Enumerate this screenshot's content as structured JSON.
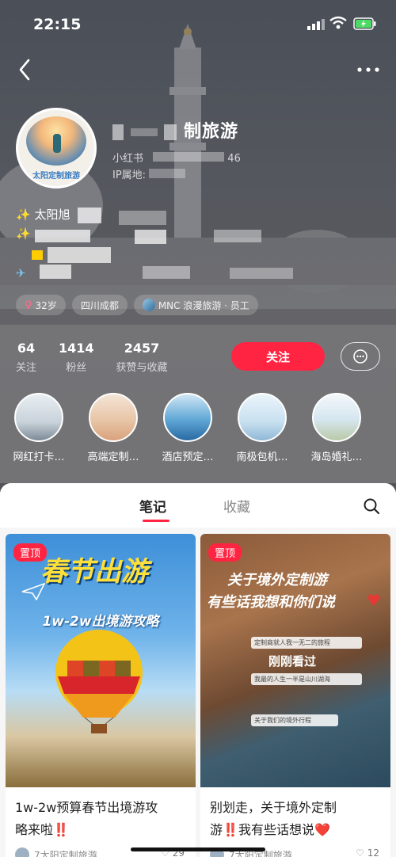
{
  "status_bar": {
    "time": "22:15"
  },
  "profile": {
    "name": "制旅游",
    "platform_line": "小红书",
    "id_suffix": "46",
    "ip_label": "IP属地:",
    "avatar_text": "太阳定制旅游",
    "bio_line1": "太阳旭",
    "tags": [
      {
        "icon": "female-icon",
        "text": "32岁"
      },
      {
        "icon": "",
        "text": "四川成都"
      },
      {
        "icon": "company-logo-icon",
        "text": "MNC 浪漫旅游 · 员工"
      }
    ]
  },
  "stats": [
    {
      "value": "64",
      "label": "关注"
    },
    {
      "value": "1414",
      "label": "粉丝"
    },
    {
      "value": "2457",
      "label": "获赞与收藏"
    }
  ],
  "actions": {
    "follow_label": "关注"
  },
  "collections": [
    {
      "label": "网红打卡…"
    },
    {
      "label": "高端定制…"
    },
    {
      "label": "酒店预定…"
    },
    {
      "label": "南极包机…"
    },
    {
      "label": "海岛婚礼…"
    }
  ],
  "tabs": {
    "notes": "笔记",
    "favorites": "收藏"
  },
  "notes": [
    {
      "badge": "置顶",
      "cover_headline": "春节出游",
      "cover_sub": "1w-2w出境游攻略",
      "title_line1": "1w-2w预算春节出境游攻",
      "title_line2": "略来啦",
      "title_emoji": "‼️",
      "author": "7太阳定制旅游",
      "likes": "29"
    },
    {
      "badge": "置顶",
      "cover_headline1": "关于境外定制游",
      "cover_headline2": "有些话我想和你们说",
      "cover_mid": "刚刚看过",
      "cover_bubble1": "定制商就人我一无二的旅程",
      "cover_bubble2": "我最的人生一半是山川湖海",
      "cover_bubble3": "关于我们的境外行程",
      "title_line1": "别划走，关于境外定制",
      "title_line2": "游",
      "title_line2b": "我有些话想说",
      "title_emoji": "‼️",
      "title_heart": "❤️",
      "author": "7太阳定制旅游",
      "likes": "12"
    }
  ],
  "colors": {
    "accent": "#ff2442",
    "hero_bg": "#545458",
    "sheet_bg": "#f6f6f6"
  }
}
